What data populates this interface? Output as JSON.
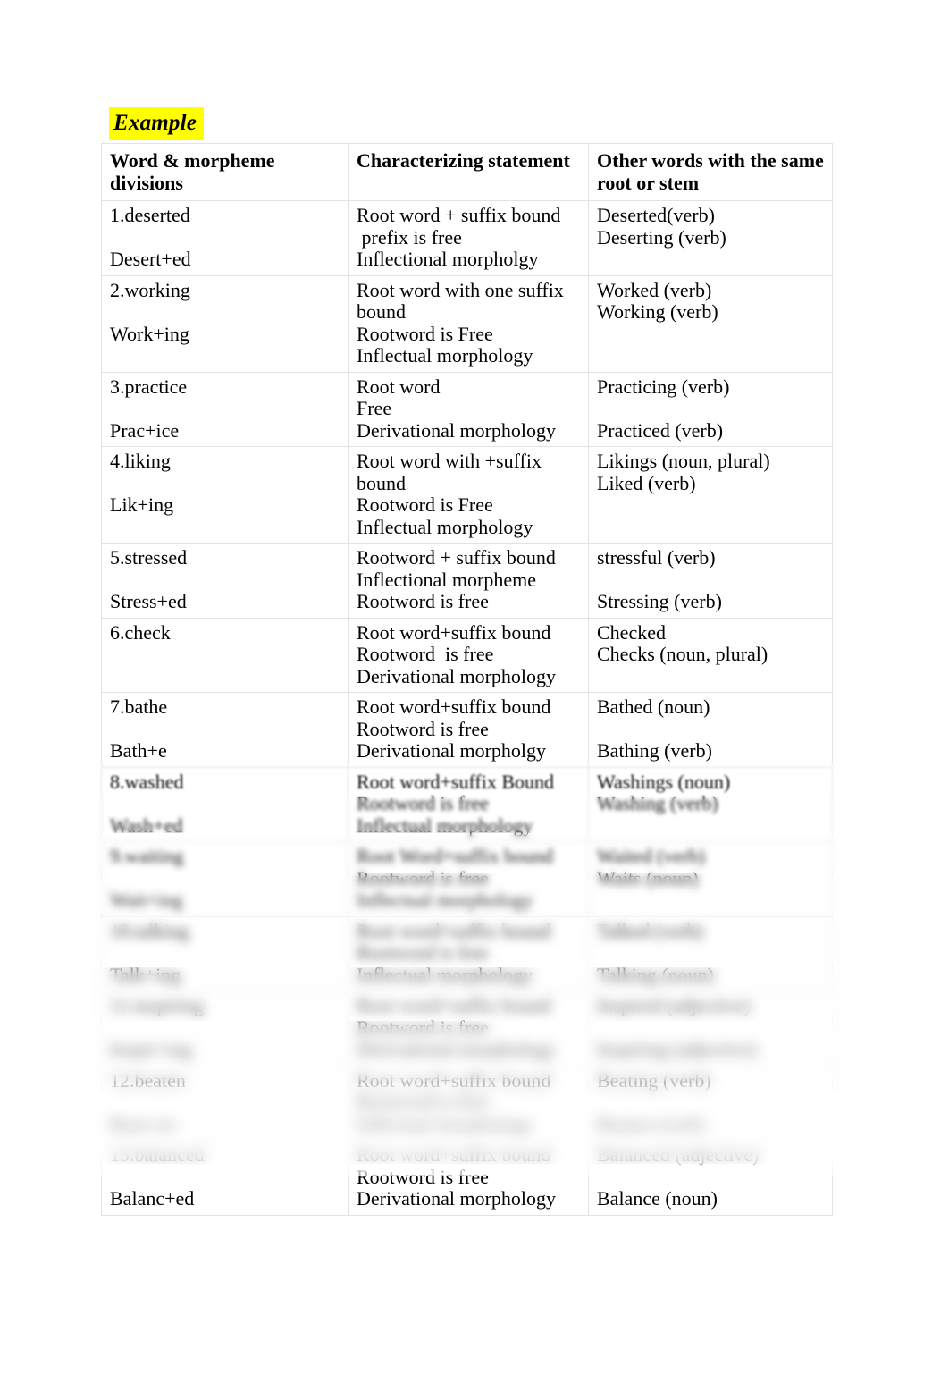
{
  "document": {
    "heading": "Example",
    "heading_highlight_color": "#ffff00",
    "background_color": "#ffffff",
    "table_border_color": "#e2e2e2"
  },
  "table": {
    "headers": [
      "Word & morpheme divisions",
      "Characterizing statement",
      "Other words with the same root or stem"
    ],
    "rows": [
      {
        "col1": [
          "1.deserted",
          "",
          "Desert+ed"
        ],
        "col2": [
          "Root word + suffix bound",
          " prefix is free",
          "Inflectional morpholgy"
        ],
        "col3": [
          "Deserted(verb)",
          "Deserting (verb)"
        ],
        "blurred": false
      },
      {
        "col1": [
          "2.working",
          "",
          "Work+ing"
        ],
        "col2": [
          "Root word with one suffix bound",
          "Rootword is Free",
          "Inflectual morphology"
        ],
        "col3": [
          "Worked (verb)",
          "Working (verb)"
        ],
        "blurred": false
      },
      {
        "col1": [
          "3.practice",
          "",
          "Prac+ice"
        ],
        "col2": [
          "Root word",
          "Free",
          "Derivational morphology"
        ],
        "col3": [
          "Practicing (verb)",
          "",
          "Practiced (verb)"
        ],
        "blurred": false
      },
      {
        "col1": [
          "4.liking",
          "",
          "Lik+ing"
        ],
        "col2": [
          "Root word with +suffix bound",
          "Rootword is Free",
          "Inflectual morphology"
        ],
        "col3": [
          "Likings (noun, plural)",
          "Liked (verb)"
        ],
        "blurred": false
      },
      {
        "col1": [
          "5.stressed",
          "",
          "Stress+ed"
        ],
        "col2": [
          "Rootword + suffix bound",
          "Inflectional morpheme",
          "Rootword is free"
        ],
        "col3": [
          "stressful (verb)",
          "",
          "Stressing (verb)"
        ],
        "blurred": false
      },
      {
        "col1": [
          "6.check"
        ],
        "col2": [
          "Root word+suffix bound",
          "Rootword  is free",
          "Derivational morphology"
        ],
        "col3": [
          "Checked",
          "Checks (noun, plural)"
        ],
        "blurred": false
      },
      {
        "col1": [
          "7.bathe",
          "",
          "Bath+e"
        ],
        "col2": [
          "Root word+suffix bound",
          "Rootword is free",
          "Derivational morpholgy"
        ],
        "col3": [
          "Bathed (noun)",
          "",
          "Bathing (verb)"
        ],
        "blurred": false
      },
      {
        "col1": [
          "8.washed",
          "",
          "Wash+ed"
        ],
        "col2": [
          "Root word+suffix Bound",
          "Rootword is free",
          "Inflectual morphology"
        ],
        "col3": [
          "Washings (noun)",
          "Washing (verb)"
        ],
        "blurred": false
      },
      {
        "col1": [
          "9.waiting",
          "",
          "Wait+ing"
        ],
        "col2": [
          "Root Word+suffix bound",
          "Rootword is free",
          "Inflectual morphology"
        ],
        "col3": [
          "Waited (verb)",
          "Waits (noun)"
        ],
        "blurred": true
      },
      {
        "col1": [
          "10.talking",
          "",
          "Talk+ing"
        ],
        "col2": [
          "Root word+suffix bound",
          "Rootword is free",
          "Inflectual morphology"
        ],
        "col3": [
          "Talked (verb)",
          "",
          "Talking (noun)"
        ],
        "blurred": true
      },
      {
        "col1": [
          "11.inspiring",
          "",
          "Inspir+ing"
        ],
        "col2": [
          "Root word+suffix bound",
          "Rootword is free",
          "Derivational morphology"
        ],
        "col3": [
          "Inspired (adjective)",
          "",
          "Inspiring (adjective)"
        ],
        "blurred": true
      },
      {
        "col1": [
          "12.beaten",
          "",
          "Beat+en"
        ],
        "col2": [
          "Root word+suffix bound",
          "Rootword is free",
          "Inflectual morphology"
        ],
        "col3": [
          "Beating (verb)",
          "",
          "Beaten (verb)"
        ],
        "blurred": true
      },
      {
        "col1": [
          "13.balanced",
          "",
          "Balanc+ed"
        ],
        "col2": [
          "Root word+suffix bound",
          "Rootword is free",
          "Derivational morphology"
        ],
        "col3": [
          "Balanced (adjective)",
          "",
          "Balance (noun)"
        ],
        "blurred": true
      }
    ]
  }
}
